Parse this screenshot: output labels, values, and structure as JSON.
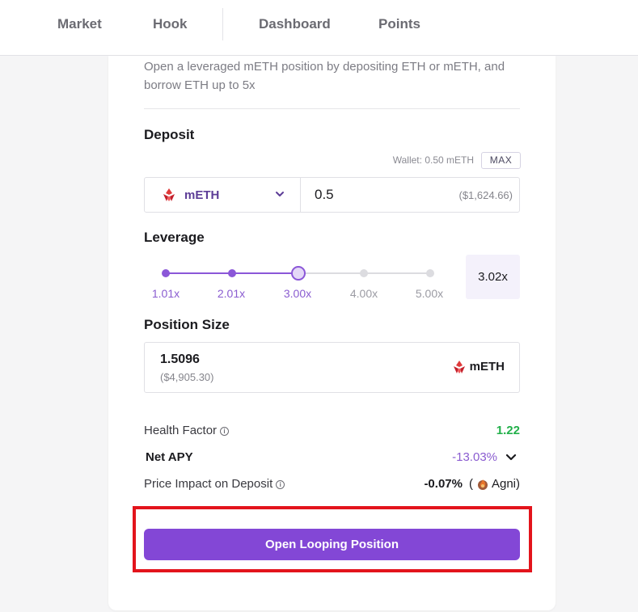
{
  "nav": {
    "items": [
      {
        "label": "Market"
      },
      {
        "label": "Hook"
      },
      {
        "label": "Dashboard"
      },
      {
        "label": "Points"
      }
    ]
  },
  "card": {
    "description": "Open a leveraged mETH position by depositing ETH or mETH, and borrow ETH up to 5x",
    "deposit": {
      "title": "Deposit",
      "wallet_text": "Wallet: 0.50 mETH",
      "max_label": "MAX",
      "token": "mETH",
      "amount": "0.5",
      "amount_usd": "($1,624.66)"
    },
    "leverage": {
      "title": "Leverage",
      "ticks": [
        "1.01x",
        "2.01x",
        "3.00x",
        "4.00x",
        "5.00x"
      ],
      "selected_value": "3.02x",
      "selected_fraction": 0.5,
      "active_tick_count": 3
    },
    "position": {
      "title": "Position Size",
      "amount": "1.5096",
      "amount_usd": "($4,905.30)",
      "token": "mETH"
    },
    "stats": {
      "health_factor_label": "Health Factor",
      "health_factor_value": "1.22",
      "net_apy_label": "Net APY",
      "net_apy_value": "-13.03%",
      "price_impact_label": "Price Impact on Deposit",
      "price_impact_value": "-0.07%",
      "price_impact_source": "Agni"
    },
    "cta_label": "Open Looping Position"
  },
  "colors": {
    "accent": "#8347d6",
    "health_green": "#22b04a",
    "apy_purple": "#8a5cd0",
    "highlight_red": "#e3141c"
  }
}
